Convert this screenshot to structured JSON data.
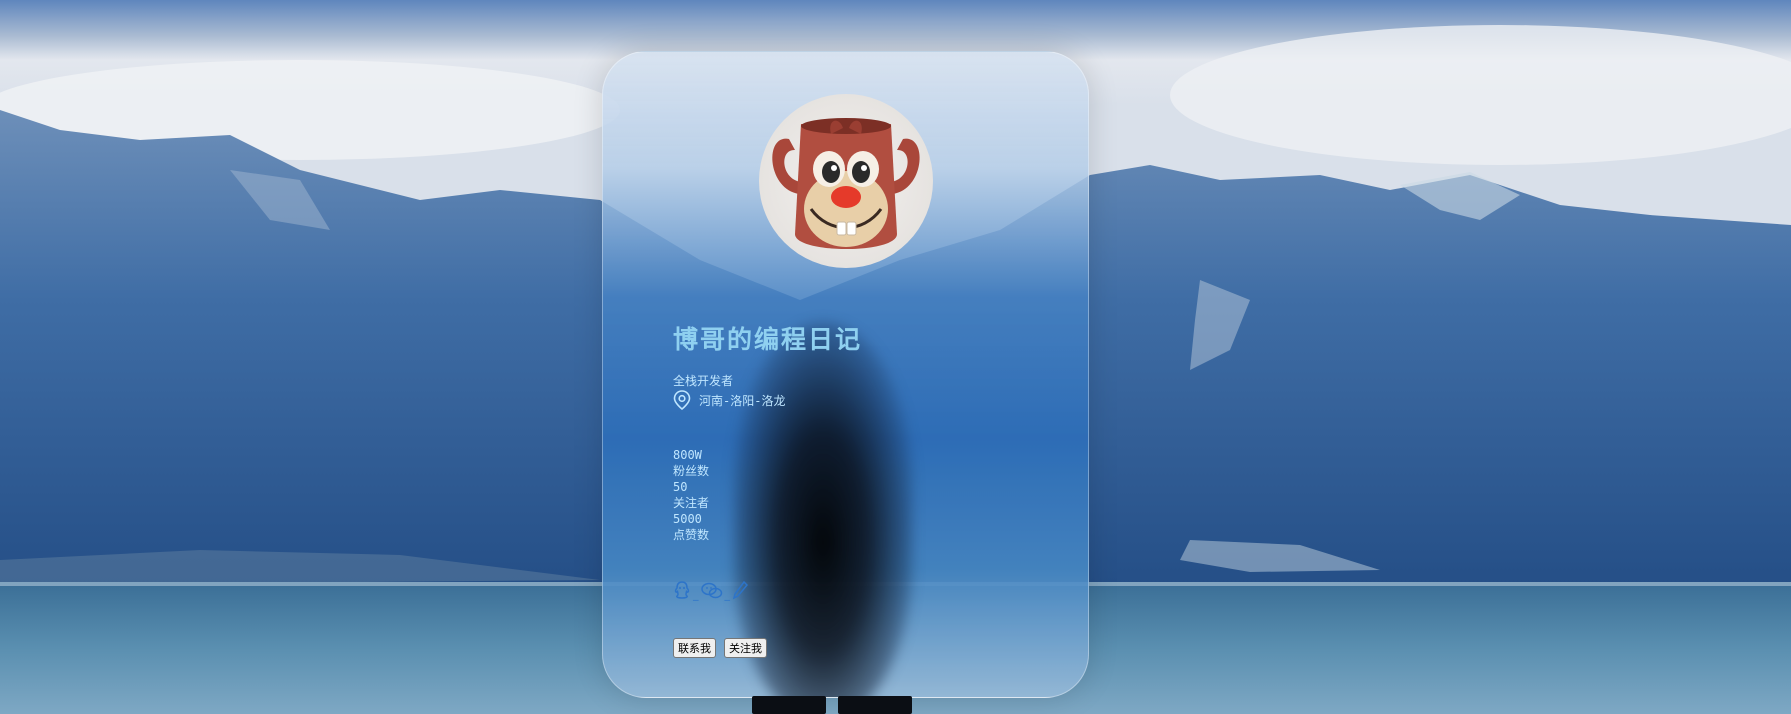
{
  "profile": {
    "name": "博哥的编程日记",
    "role": "全栈开发者",
    "location": "河南-洛阳-洛龙"
  },
  "stats": [
    {
      "value": "800W",
      "label": "粉丝数"
    },
    {
      "value": "50",
      "label": "关注者"
    },
    {
      "value": "5000",
      "label": "点赞数"
    }
  ],
  "socials": [
    {
      "icon": "qq-icon"
    },
    {
      "icon": "wechat-icon"
    },
    {
      "icon": "pen-icon"
    }
  ],
  "buttons": {
    "contact_label": "联系我",
    "follow_label": "关注我"
  },
  "colors": {
    "title": "#8fd0f0",
    "text": "#bfe6ff",
    "icon": "#2d74c9"
  }
}
